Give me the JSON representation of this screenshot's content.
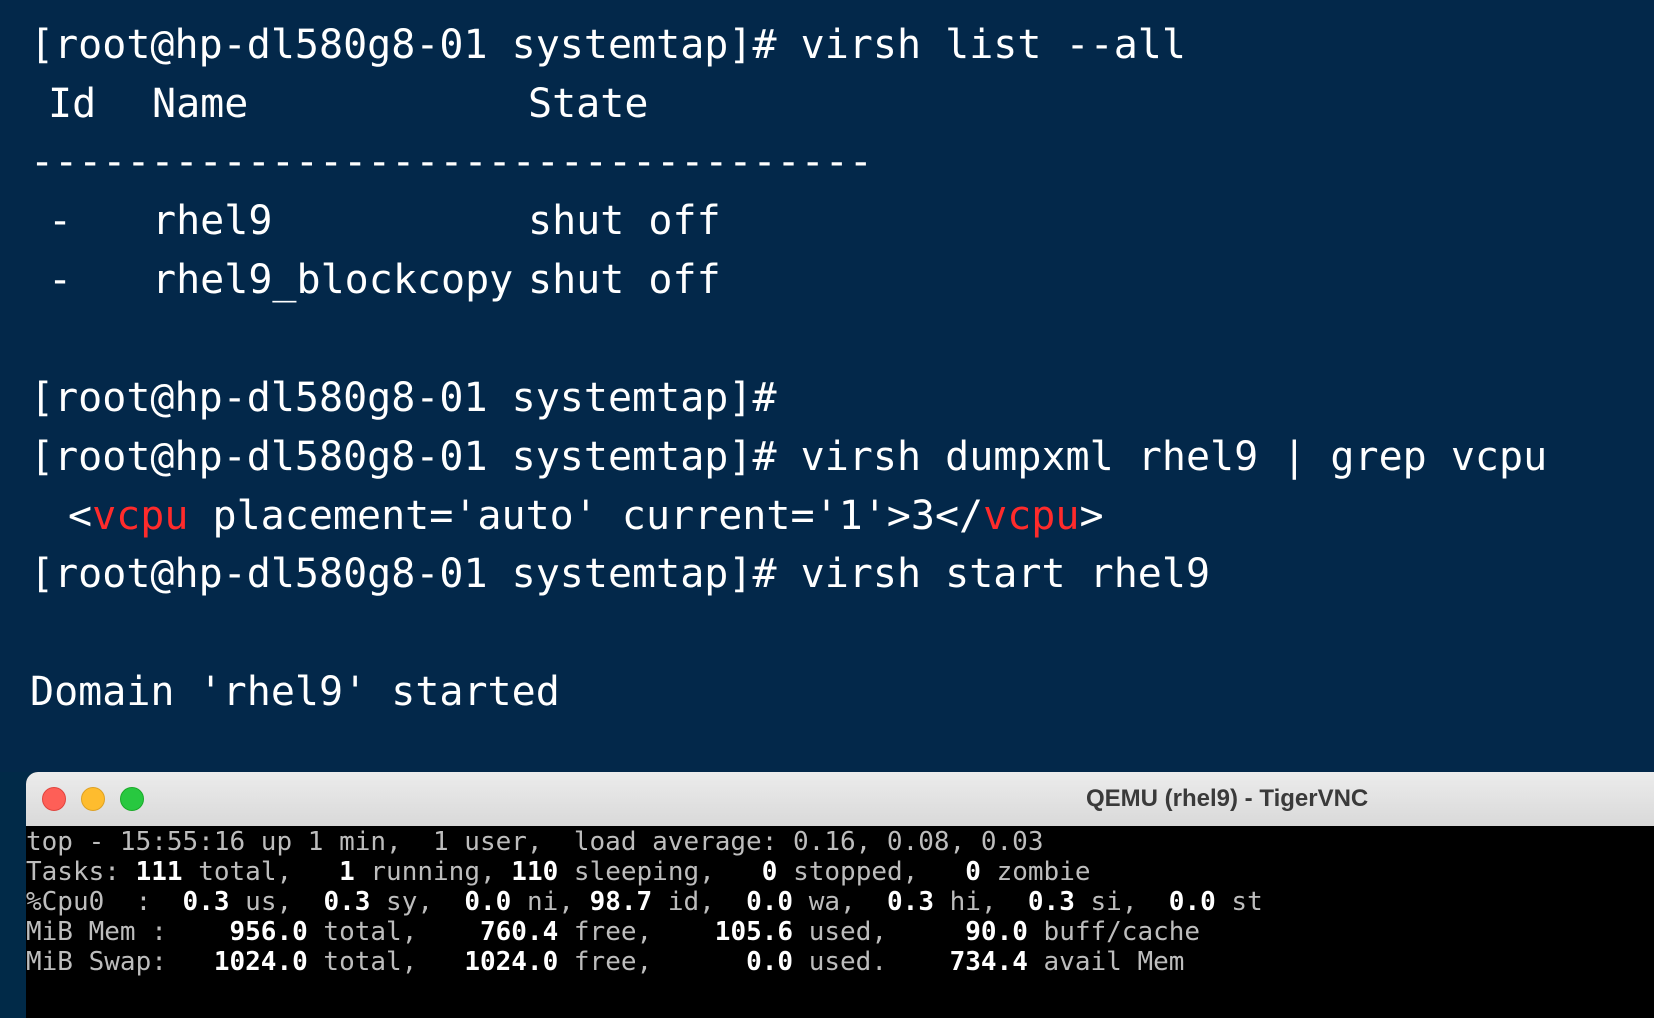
{
  "terminal": {
    "cmd1": "[root@hp-dl580g8-01 systemtap]# virsh list --all",
    "header_id": "Id",
    "header_name": "Name",
    "header_state": "State",
    "separator": "-----------------------------------",
    "rows": [
      {
        "id": "-",
        "name": "rhel9",
        "state": "shut off"
      },
      {
        "id": "-",
        "name": "rhel9_blockcopy",
        "state": "shut off"
      }
    ],
    "prompt_empty": "[root@hp-dl580g8-01 systemtap]#",
    "cmd2": "[root@hp-dl580g8-01 systemtap]# virsh dumpxml rhel9 | grep vcpu",
    "xml": {
      "open_lt": "<",
      "tag": "vcpu",
      "attrs": " placement='auto' current='1'>3</",
      "close_gt": ">"
    },
    "cmd3": "[root@hp-dl580g8-01 systemtap]# virsh start rhel9",
    "result": "Domain 'rhel9' started"
  },
  "vnc_window": {
    "title": "QEMU (rhel9) - TigerVNC",
    "console_lines": {
      "l1": "top - 15:55:16 up 1 min,  1 user,  load average: 0.16, 0.08, 0.03",
      "l2": {
        "a": "Tasks: ",
        "b": "111",
        "c": " total,   ",
        "d": "1",
        "e": " running, ",
        "f": "110",
        "g": " sleeping,   ",
        "h": "0",
        "i": " stopped,   ",
        "j": "0",
        "k": " zombie"
      },
      "l3": {
        "a": "%Cpu0  :  ",
        "b": "0.3",
        "c": " us,  ",
        "d": "0.3",
        "e": " sy,  ",
        "f": "0.0",
        "g": " ni, ",
        "h": "98.7",
        "i": " id,  ",
        "j": "0.0",
        "k": " wa,  ",
        "l": "0.3",
        "m": " hi,  ",
        "n": "0.3",
        "o": " si,  ",
        "p": "0.0",
        "q": " st"
      },
      "l4": {
        "a": "MiB Mem :    ",
        "b": "956.0",
        "c": " total,    ",
        "d": "760.4",
        "e": " free,    ",
        "f": "105.6",
        "g": " used,     ",
        "h": "90.0",
        "i": " buff/cache"
      },
      "l5": {
        "a": "MiB Swap:   ",
        "b": "1024.0",
        "c": " total,   ",
        "d": "1024.0",
        "e": " free,      ",
        "f": "0.0",
        "g": " used.    ",
        "h": "734.4",
        "i": " avail Mem"
      }
    }
  },
  "colors": {
    "terminal_bg": "#03284a",
    "keyword_red": "#ff2b2b"
  }
}
